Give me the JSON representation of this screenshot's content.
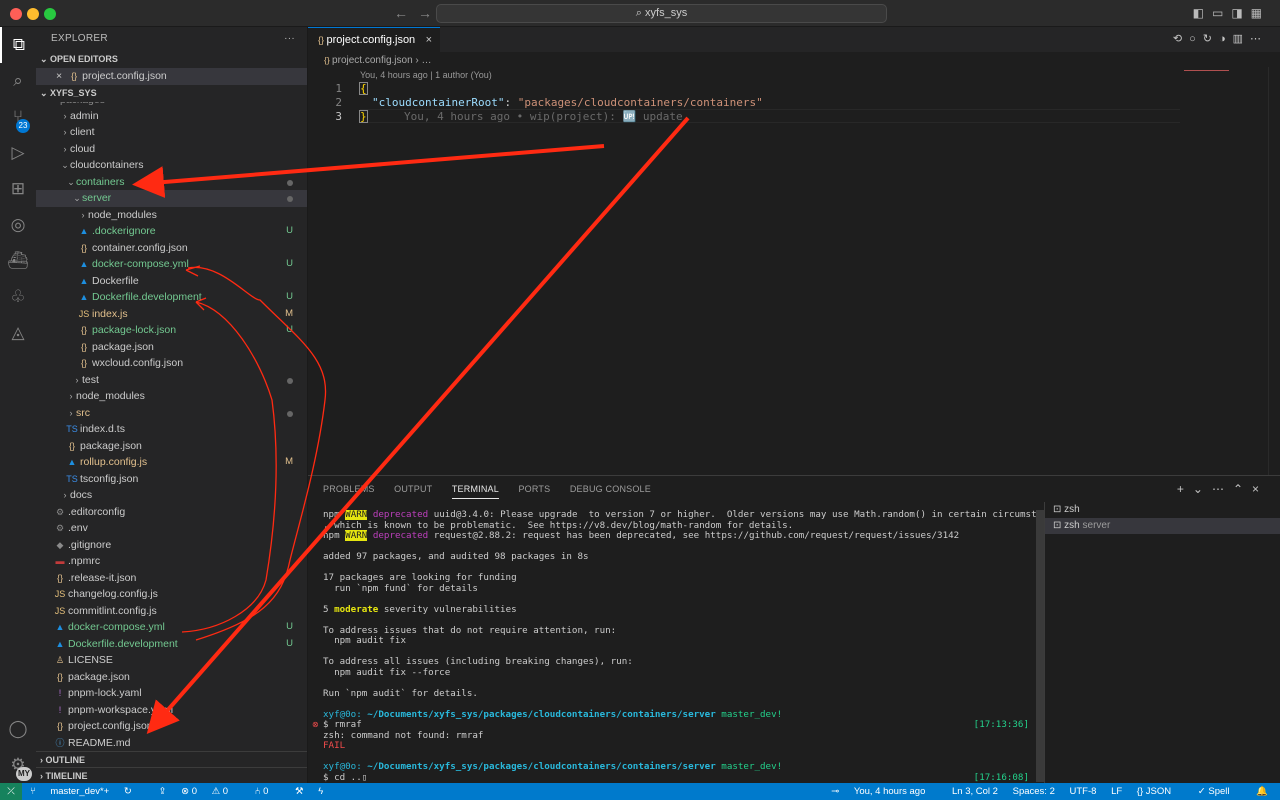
{
  "window": {
    "search": "xyfs_sys"
  },
  "activity": {
    "scm_badge": "23",
    "account_badge": "MY"
  },
  "explorer": {
    "title": "EXPLORER",
    "more": "···",
    "open_editors_label": "OPEN EDITORS",
    "open_editor_file": "project.config.json",
    "workspace_label": "XYFS_SYS",
    "cut_label": "packages",
    "outline_label": "OUTLINE",
    "timeline_label": "TIMELINE",
    "tree": [
      {
        "label": "admin",
        "status": ""
      },
      {
        "label": "client",
        "status": ""
      },
      {
        "label": "cloud",
        "status": ""
      },
      {
        "label": "cloudcontainers",
        "status": ""
      },
      {
        "label": "containers",
        "status": ""
      },
      {
        "label": "server",
        "status": ""
      },
      {
        "label": "node_modules",
        "status": ""
      },
      {
        "label": ".dockerignore",
        "status": "U"
      },
      {
        "label": "container.config.json",
        "status": ""
      },
      {
        "label": "docker-compose.yml",
        "status": "U"
      },
      {
        "label": "Dockerfile",
        "status": ""
      },
      {
        "label": "Dockerfile.development",
        "status": "U"
      },
      {
        "label": "index.js",
        "status": "M"
      },
      {
        "label": "package-lock.json",
        "status": "U"
      },
      {
        "label": "package.json",
        "status": ""
      },
      {
        "label": "wxcloud.config.json",
        "status": ""
      },
      {
        "label": "test",
        "status": ""
      },
      {
        "label": "node_modules",
        "status": ""
      },
      {
        "label": "src",
        "status": ""
      },
      {
        "label": "index.d.ts",
        "status": ""
      },
      {
        "label": "package.json",
        "status": ""
      },
      {
        "label": "rollup.config.js",
        "status": "M"
      },
      {
        "label": "tsconfig.json",
        "status": ""
      },
      {
        "label": "docs",
        "status": ""
      },
      {
        "label": ".editorconfig",
        "status": ""
      },
      {
        "label": ".env",
        "status": ""
      },
      {
        "label": ".gitignore",
        "status": ""
      },
      {
        "label": ".npmrc",
        "status": ""
      },
      {
        "label": ".release-it.json",
        "status": ""
      },
      {
        "label": "changelog.config.js",
        "status": ""
      },
      {
        "label": "commitlint.config.js",
        "status": ""
      },
      {
        "label": "docker-compose.yml",
        "status": "U"
      },
      {
        "label": "Dockerfile.development",
        "status": "U"
      },
      {
        "label": "LICENSE",
        "status": ""
      },
      {
        "label": "package.json",
        "status": ""
      },
      {
        "label": "pnpm-lock.yaml",
        "status": ""
      },
      {
        "label": "pnpm-workspace.yaml",
        "status": ""
      },
      {
        "label": "project.config.json",
        "status": ""
      },
      {
        "label": "README.md",
        "status": ""
      }
    ]
  },
  "editor": {
    "tab_label": "project.config.json",
    "breadcrumb_file": "project.config.json",
    "breadcrumb_rest": "…",
    "codelens": "You, 4 hours ago | 1 author (You)",
    "line_numbers": [
      "1",
      "2",
      "3"
    ],
    "line1": "{",
    "line2_key": "\"cloudcontainerRoot\"",
    "line2_colon": ": ",
    "line2_value": "\"packages/cloudcontainers/containers\"",
    "line3": "}",
    "blame": "You, 4 hours ago • wip(project): 🆙 update"
  },
  "panel": {
    "tabs": [
      "PROBLEMS",
      "OUTPUT",
      "TERMINAL",
      "PORTS",
      "DEBUG CONSOLE"
    ],
    "active_tab": "TERMINAL",
    "terminals": [
      {
        "name": "zsh",
        "sub": ""
      },
      {
        "name": "zsh",
        "sub": "server"
      }
    ],
    "term": {
      "npm": "npm",
      "warn": "WARN",
      "deprecated": "deprecated",
      "w1": " uuid@3.4.0: Please upgrade  to version 7 or higher.  Older versions may use Math.random() in certain circumstances",
      "w1b": ", which is known to be problematic.  See https://v8.dev/blog/math-random for details.",
      "w2": " request@2.88.2: request has been deprecated, see https://github.com/request/request/issues/3142",
      "added": "added 97 packages, and audited 98 packages in 8s",
      "funding1": "17 packages are looking for funding",
      "funding2": "  run `npm fund` for details",
      "vuln_pre": "5 ",
      "vuln_mod": "moderate",
      "vuln_post": " severity vulnerabilities",
      "fix1": "To address issues that do not require attention, run:",
      "fix1b": "  npm audit fix",
      "fix2": "To address all issues (including breaking changes), run:",
      "fix2b": "  npm audit fix --force",
      "run": "Run `npm audit` for details.",
      "prompt_user": "xyf@0o:",
      "prompt_path": " ~/Documents/xyfs_sys/packages/cloudcontainers/containers/server",
      "prompt_branch": " master_dev!",
      "cmd1": "$ rmraf",
      "time1": "[17:13:36]",
      "err": "zsh: command not found: rmraf",
      "fail": "FAIL",
      "cmd2": "$ cd ..▯",
      "time2": "[17:16:08]"
    }
  },
  "statusbar": {
    "branch": "master_dev*+",
    "errors": "0",
    "warnings": "0",
    "ports": "0",
    "blame": "You, 4 hours ago",
    "position": "Ln 3, Col 2",
    "spaces": "Spaces: 2",
    "encoding": "UTF-8",
    "eol": "LF",
    "language": "JSON",
    "spell": "Spell"
  },
  "colors": {
    "accent": "#007acc",
    "annotation": "#ff2a12",
    "untracked": "#73c991",
    "modified": "#e2c08d"
  }
}
